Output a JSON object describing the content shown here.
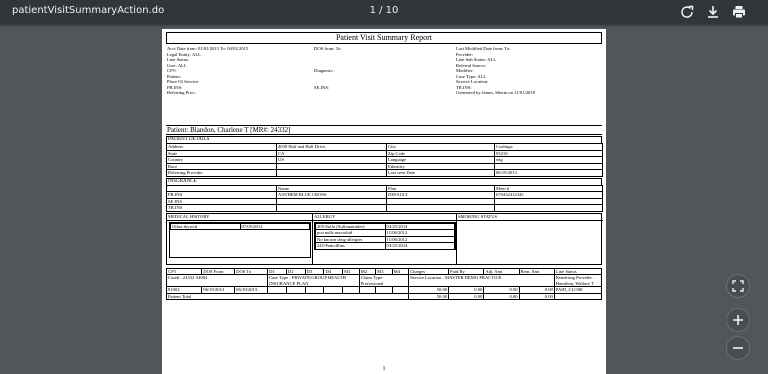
{
  "viewer": {
    "filename": "patientVisitSummaryAction.do",
    "page_indicator": "1 / 10"
  },
  "report": {
    "title": "Patient Visit Summary Report",
    "header": {
      "col1": [
        "Acct Date from: 01/01/2015 To: 04/01/2015",
        "Legal Entity: ALL",
        "Line Status:",
        "User: ALL",
        "CPT:",
        "Patient:",
        "Place Of Service:",
        "PR.INS:",
        "Referring Prov.:"
      ],
      "col2": [
        "DOS from:  To:",
        "",
        "",
        "",
        "Diagnosis :",
        "",
        "",
        "SE.INS:",
        ""
      ],
      "col3": [
        "Last Modified Date from:  To:",
        "Provider:",
        "Line Sub Status: ALL",
        "Referral Source:",
        "Modifier:",
        "Case Type: ALL",
        "Service Location:",
        "TR.INS:",
        "Generated by James, Sherin on 11/01/2018"
      ]
    },
    "patient_line": "Patient: Blandon, Charlene T [MR#: 24332]",
    "details_title": "PATIENT DETAILS",
    "details": [
      [
        "Address",
        "4039 Half and Half Drive,",
        "City",
        "Coalinga"
      ],
      [
        "State",
        "CA",
        "Zip Code",
        "93210"
      ],
      [
        "Country",
        "US",
        "Language",
        "eng"
      ],
      [
        "Race",
        "",
        "Ethnicity",
        ""
      ],
      [
        "Referring Provider",
        "",
        "Last seen Date",
        "06/19/2013"
      ]
    ],
    "insurance_title": "INSURANCE",
    "insurance_header": [
      "",
      "Name",
      "Plan",
      "Mem #"
    ],
    "insurance": [
      [
        "PR.INS",
        "ANTHEM BLUE CROSS",
        "DEFAULT",
        "670432412345"
      ],
      [
        "SE.INS",
        "",
        "",
        ""
      ],
      [
        "TR.INS",
        "",
        "",
        ""
      ]
    ],
    "medical_history_title": "MEDICAL HISTORY",
    "allergy_title": "ALLERGY",
    "smoking_title": "SMOKING STATUS",
    "medical_history": [
      [
        "Other:thyroid",
        "07/05/2012"
      ]
    ],
    "allergies": [
      [
        "205-Sulfa (Sulfonamides)",
        "03/25/2014"
      ],
      [
        "pcn nulls macrobid",
        "11/06/2012"
      ],
      [
        "No known drug allergies",
        "11/06/2012"
      ],
      [
        "245-Penicillins",
        "03/25/2014"
      ]
    ],
    "claims_header": [
      "CPT",
      "DOS From",
      "DOS To",
      "D1",
      "D2",
      "D3",
      "D4",
      "M1",
      "M2",
      "M3",
      "M4",
      "Charges",
      "Paid By",
      "Adj. Amt",
      "Rem. Amt",
      "Line Status"
    ],
    "case_row": {
      "case": "Case# : 24332-34004",
      "case_type": "Case Type : PRIVATE/GROUP HEALTH INSURANCE PLAN",
      "claim_type": "Claim Type : Professional",
      "service_location": "Service Location : MASTER DEMO PRACTICE",
      "rendering": "Rendering Provider : Hamilton, Wallace T"
    },
    "line_row": [
      "81002",
      "06/19/2013",
      "06/19/2013",
      "",
      "",
      "",
      "",
      "",
      "",
      "",
      "",
      "50.00",
      "0.00",
      "0.00",
      "0.00",
      "PAID_CLOSE"
    ],
    "total_row": [
      "Patient Total",
      "50.00",
      "0.00",
      "0.00",
      "0.00"
    ],
    "page_number": "1"
  },
  "icons": [
    "rotate-icon",
    "download-icon",
    "print-icon",
    "fit-page-icon",
    "zoom-in-icon",
    "zoom-out-icon"
  ]
}
